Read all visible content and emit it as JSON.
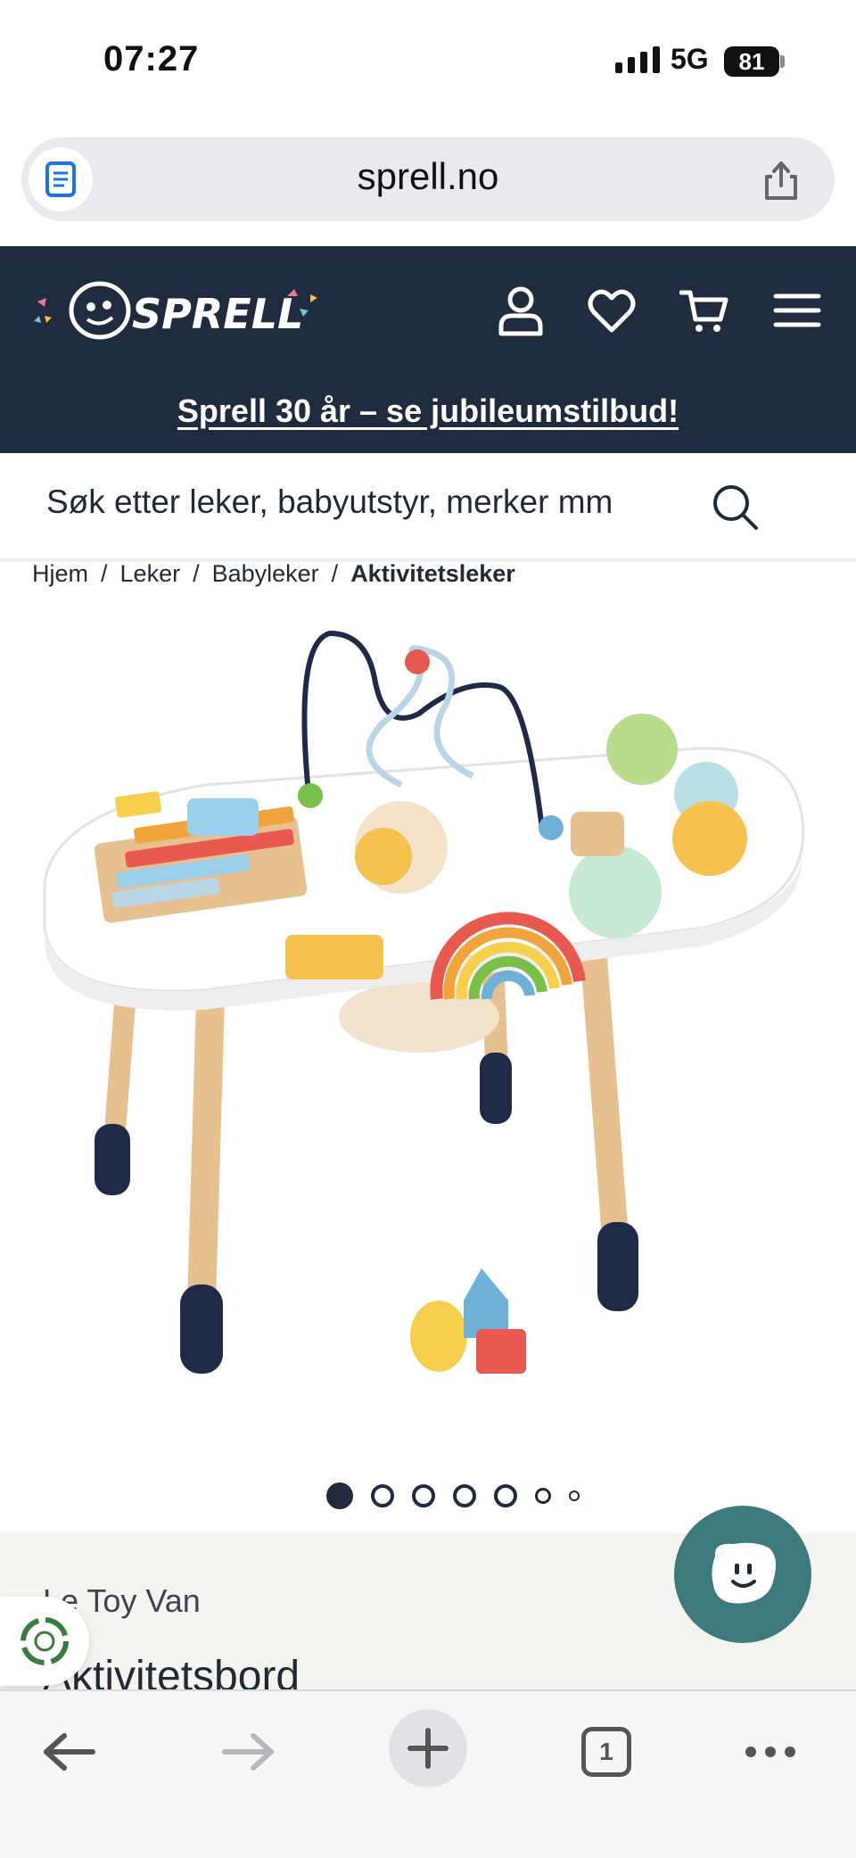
{
  "status_bar": {
    "time": "07:27",
    "network": "5G",
    "battery": "81"
  },
  "browser": {
    "url": "sprell.no",
    "tab_count": "1"
  },
  "site": {
    "logo_text": "SPRELL",
    "promo": "Sprell 30 år – se jubileumstilbud!",
    "search_placeholder": "Søk etter leker, babyutstyr, merker mm",
    "icons": [
      "user-icon",
      "heart-icon",
      "cart-icon",
      "menu-icon"
    ]
  },
  "breadcrumb": {
    "items": [
      "Hjem",
      "Leker",
      "Babyleker"
    ],
    "current": "Aktivitetsleker",
    "separator": "/"
  },
  "gallery": {
    "total_images": 7,
    "active_index": 0
  },
  "product": {
    "brand": "Le Toy Van",
    "title": "Aktivitetsbord"
  },
  "colors": {
    "header_bg": "#1f2b3e",
    "chat_bg": "#3c7a7c",
    "info_bg": "#f6f4f0"
  }
}
